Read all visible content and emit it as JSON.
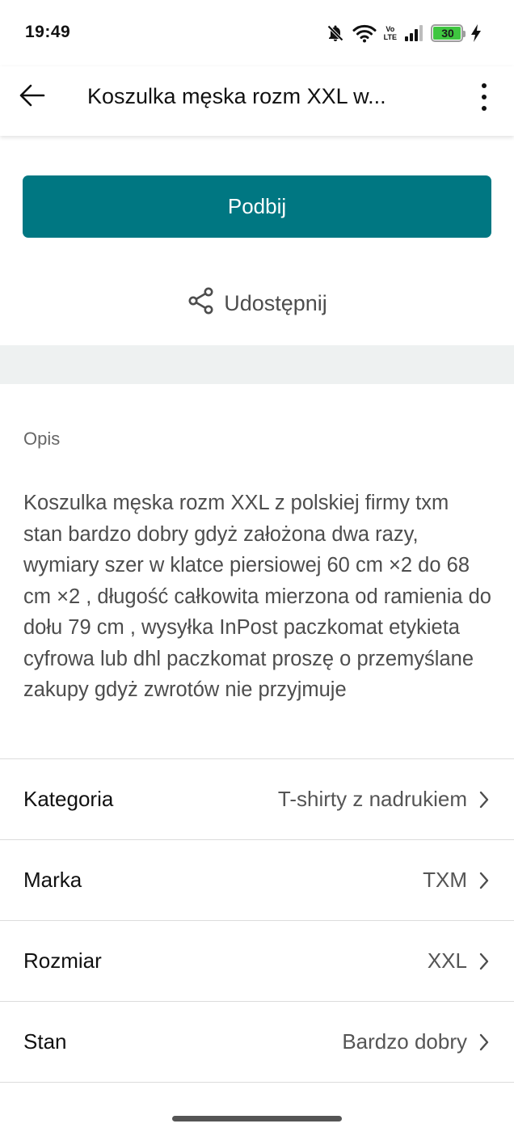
{
  "status_bar": {
    "time": "19:49",
    "volte_top": "Vo",
    "volte_bottom": "LTE",
    "battery_level": "30",
    "icons": [
      "bell-off-icon",
      "wifi-icon",
      "volte-icon",
      "signal-icon",
      "battery-icon",
      "charging-icon"
    ]
  },
  "app_bar": {
    "title": "Koszulka męska rozm XXL w...",
    "back_icon": "arrow-left-icon",
    "menu_icon": "more-vertical-icon"
  },
  "actions": {
    "bump_label": "Podbij",
    "share_label": "Udostępnij",
    "share_icon": "share-icon"
  },
  "description": {
    "label": "Opis",
    "text": "Koszulka męska rozm XXL z polskiej firmy txm stan bardzo dobry gdyż założona dwa razy, wymiary szer w klatce piersiowej 60 cm ×2 do 68 cm ×2 , długość całkowita mierzona od ramienia do dołu 79 cm , wysyłka InPost paczkomat etykieta cyfrowa lub dhl paczkomat proszę o przemyślane zakupy gdyż zwrotów nie przyjmuje"
  },
  "attributes": [
    {
      "label": "Kategoria",
      "value": "T-shirty z nadrukiem"
    },
    {
      "label": "Marka",
      "value": "TXM"
    },
    {
      "label": "Rozmiar",
      "value": "XXL"
    },
    {
      "label": "Stan",
      "value": "Bardzo dobry"
    }
  ],
  "colors": {
    "accent": "#007782",
    "band": "#eef1f1",
    "battery_fill": "#3fc640"
  }
}
